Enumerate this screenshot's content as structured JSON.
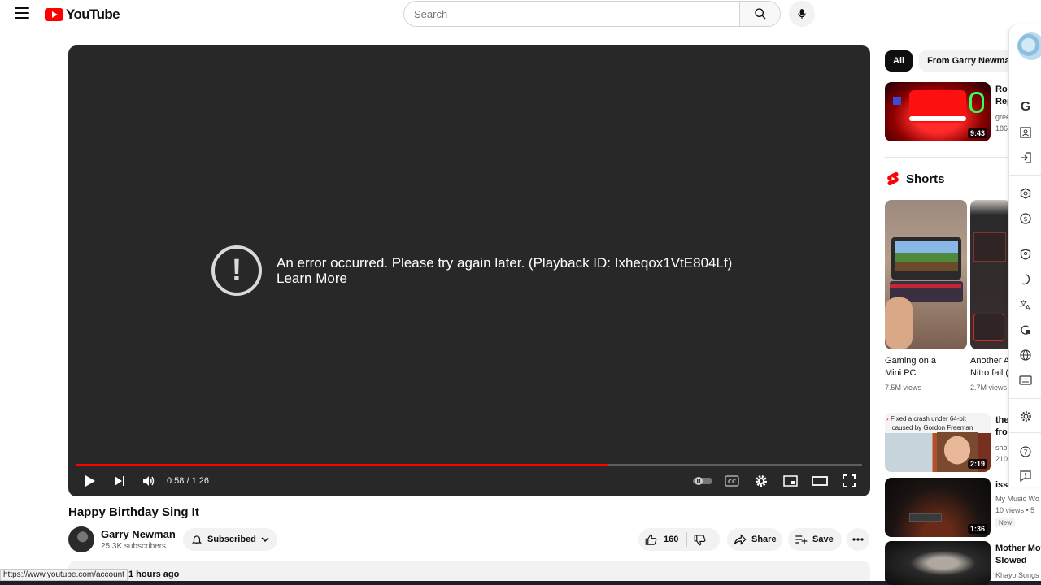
{
  "header": {
    "logo_text": "YouTube",
    "search_placeholder": "Search"
  },
  "player": {
    "error_message": "An error occurred. Please try again later. (Playback ID: Ixheqox1VtE804Lf)",
    "error_link": "Learn More",
    "time_display": "0:58 / 1:26",
    "progress_fraction": 0.676
  },
  "video": {
    "title": "Happy Birthday Sing It",
    "channel_name": "Garry Newman",
    "subscribers": "25.3K subscribers",
    "subscribed_label": "Subscribed",
    "like_count": "160",
    "share_label": "Share",
    "save_label": "Save",
    "description_meta": "1 hours ago"
  },
  "status_url": "https://www.youtube.com/account",
  "sidebar": {
    "chips": [
      "All",
      "From Garry Newman"
    ],
    "top_video": {
      "title_1": "Rob",
      "title_2": "Rep",
      "channel": "gree",
      "views": "186",
      "duration": "9:43"
    },
    "shorts_label": "Shorts",
    "shorts": [
      {
        "title_1": "Gaming on a",
        "title_2": "Mini PC",
        "views": "7.5M views"
      },
      {
        "title_1": "Another A",
        "title_2": "Nitro fail (",
        "views": "2.7M views"
      }
    ],
    "recs": [
      {
        "title": "the",
        "title_2": "fror",
        "meta_1": "sho",
        "meta_2": "210",
        "duration": "2:19",
        "thumb_text_1": "Fixed a crash under 64-bit",
        "thumb_text_2": "caused by Gordon Freeman"
      },
      {
        "title": "issu",
        "meta_1": "My Music Wo",
        "meta_2": "10 views • 5",
        "badge": "New",
        "duration": "1:36"
      },
      {
        "title": "Mother Mot",
        "title_2": "Slowed",
        "meta_1": "Khayo Songs"
      }
    ]
  },
  "colors": {
    "accent": "#ff0000",
    "player_bg": "#282828"
  }
}
